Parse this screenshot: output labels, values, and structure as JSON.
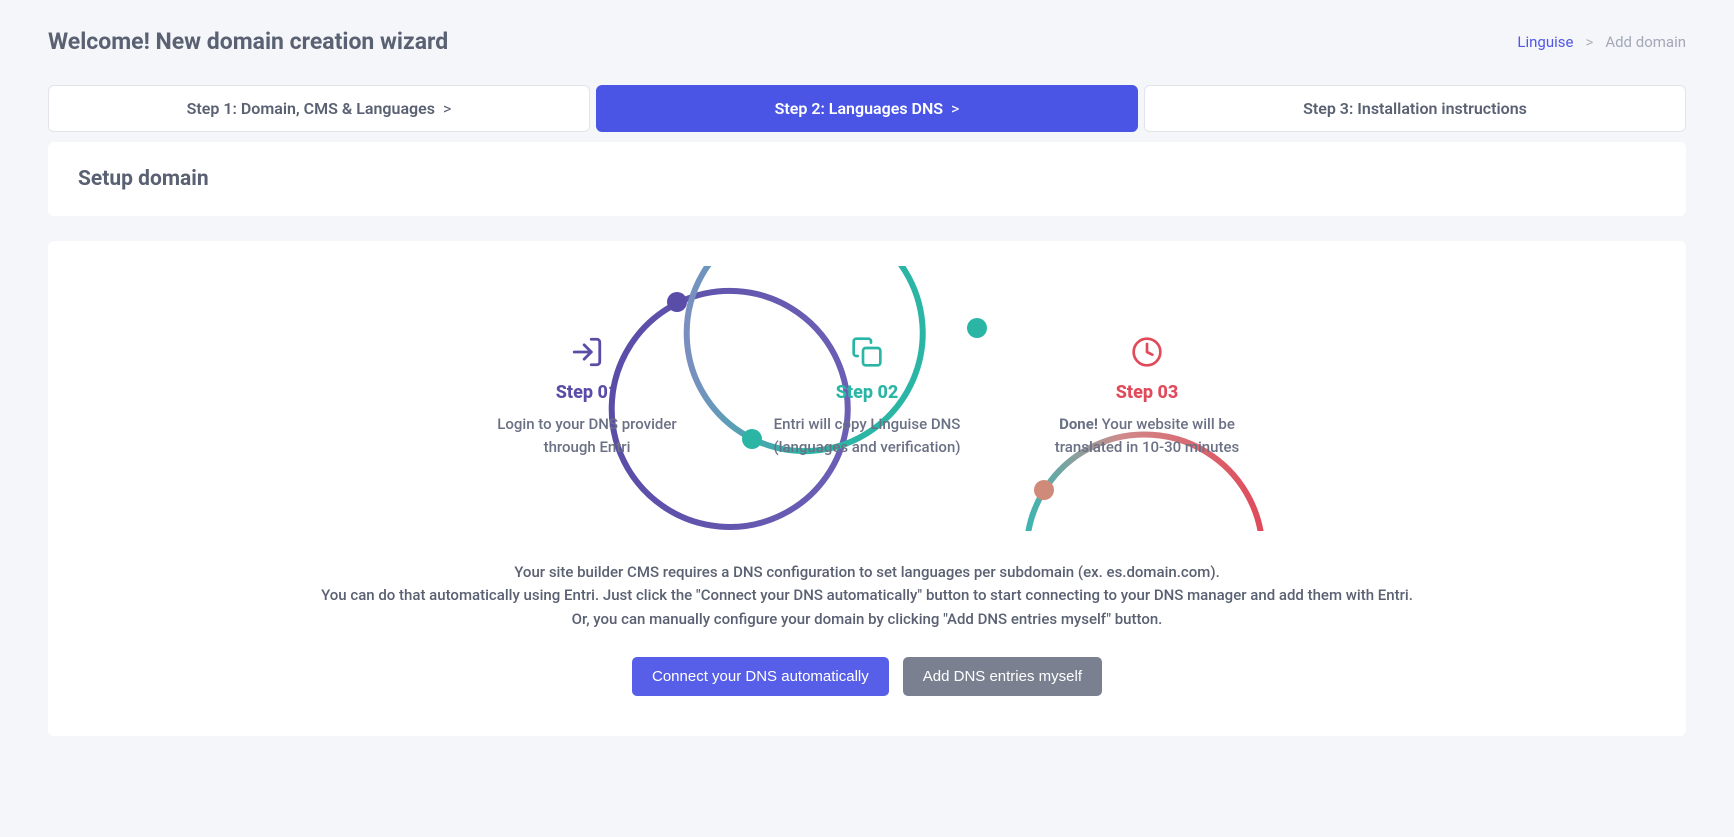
{
  "header": {
    "title": "Welcome! New domain creation wizard",
    "breadcrumb": {
      "link": "Linguise",
      "sep": ">",
      "current": "Add domain"
    }
  },
  "stepper": {
    "tabs": [
      {
        "label": "Step 1: Domain, CMS & Languages",
        "arrow": ">"
      },
      {
        "label": "Step 2: Languages DNS",
        "arrow": ">"
      },
      {
        "label": "Step 3: Installation instructions",
        "arrow": ""
      }
    ]
  },
  "card": {
    "heading": "Setup domain"
  },
  "steps": [
    {
      "title": "Step 01",
      "desc": "Login to your DNS provider through Entri"
    },
    {
      "title": "Step 02",
      "desc": "Entri will copy Linguise DNS (languages and verification)"
    },
    {
      "title": "Step 03",
      "desc_prefix": "Done!",
      "desc_rest": " Your website will be translated in 10-30 minutes"
    }
  ],
  "description": {
    "p1": "Your site builder CMS requires a DNS configuration to set languages per subdomain (ex. es.domain.com).",
    "p2": "You can do that automatically using Entri. Just click the \"Connect your DNS automatically\" button to start connecting to your DNS manager and add them with Entri.",
    "p3": "Or, you can manually configure your domain by clicking \"Add DNS entries myself\" button."
  },
  "buttons": {
    "primary": "Connect your DNS automatically",
    "secondary": "Add DNS entries myself"
  },
  "colors": {
    "purple": "#5a4da8",
    "teal": "#2ab5a5",
    "red": "#e04a5a",
    "primary": "#575fe8"
  }
}
